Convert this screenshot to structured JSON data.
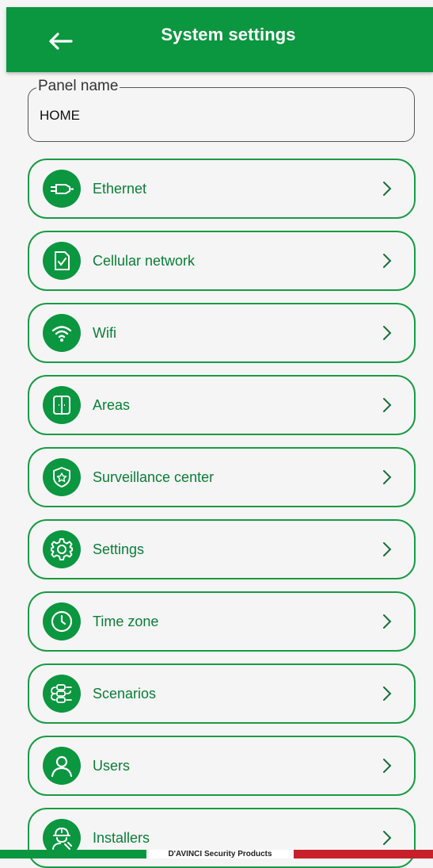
{
  "header": {
    "title": "System settings",
    "back_icon": "arrow-left-icon",
    "color": "#0b9640"
  },
  "panel_name": {
    "label": "Panel name",
    "value": "HOME"
  },
  "menu": {
    "accent": "#1a9b45",
    "items": [
      {
        "label": "Ethernet",
        "icon": "ethernet-icon"
      },
      {
        "label": "Cellular network",
        "icon": "sim-card-icon"
      },
      {
        "label": "Wifi",
        "icon": "wifi-icon"
      },
      {
        "label": "Areas",
        "icon": "areas-icon"
      },
      {
        "label": "Surveillance center",
        "icon": "police-badge-icon"
      },
      {
        "label": "Settings",
        "icon": "gear-icon"
      },
      {
        "label": "Time zone",
        "icon": "clock-icon"
      },
      {
        "label": "Scenarios",
        "icon": "scenarios-icon"
      },
      {
        "label": "Users",
        "icon": "user-icon"
      },
      {
        "label": "Installers",
        "icon": "installer-icon"
      }
    ]
  },
  "footer": {
    "brand_text": "D'AVINCI Security Products"
  }
}
